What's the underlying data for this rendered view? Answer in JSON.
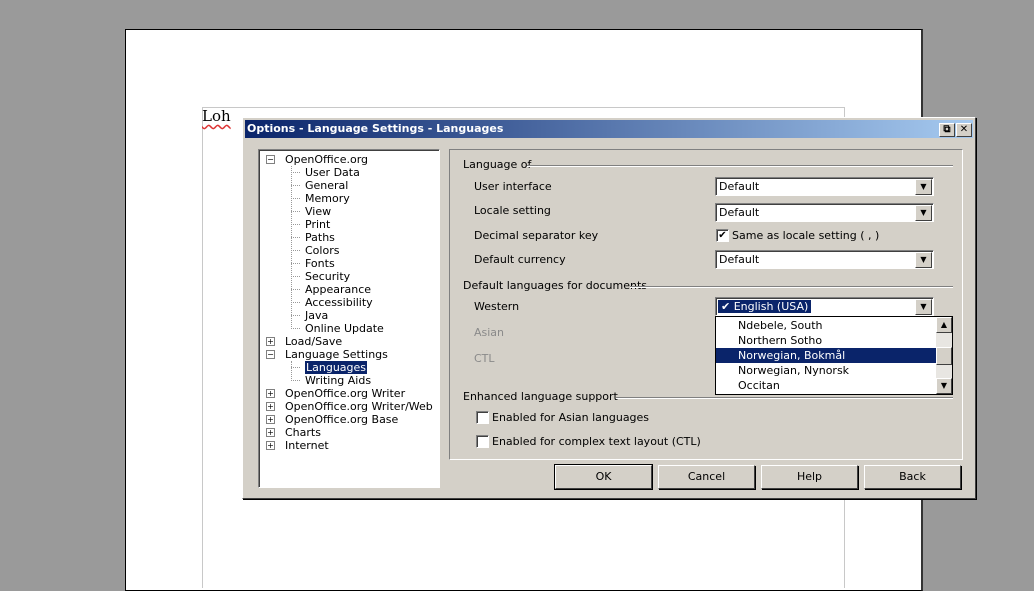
{
  "document": {
    "text": "Loh"
  },
  "dialog": {
    "title": "Options - Language Settings - Languages",
    "restore_icon": "restore-icon",
    "close_icon": "close-icon"
  },
  "tree": [
    {
      "label": "OpenOffice.org",
      "level": 0,
      "expander": "minus"
    },
    {
      "label": "User Data",
      "level": 1
    },
    {
      "label": "General",
      "level": 1
    },
    {
      "label": "Memory",
      "level": 1
    },
    {
      "label": "View",
      "level": 1
    },
    {
      "label": "Print",
      "level": 1
    },
    {
      "label": "Paths",
      "level": 1
    },
    {
      "label": "Colors",
      "level": 1
    },
    {
      "label": "Fonts",
      "level": 1
    },
    {
      "label": "Security",
      "level": 1
    },
    {
      "label": "Appearance",
      "level": 1
    },
    {
      "label": "Accessibility",
      "level": 1
    },
    {
      "label": "Java",
      "level": 1
    },
    {
      "label": "Online Update",
      "level": 1
    },
    {
      "label": "Load/Save",
      "level": 0,
      "expander": "plus"
    },
    {
      "label": "Language Settings",
      "level": 0,
      "expander": "minus"
    },
    {
      "label": "Languages",
      "level": 1,
      "selected": true
    },
    {
      "label": "Writing Aids",
      "level": 1
    },
    {
      "label": "OpenOffice.org Writer",
      "level": 0,
      "expander": "plus"
    },
    {
      "label": "OpenOffice.org Writer/Web",
      "level": 0,
      "expander": "plus"
    },
    {
      "label": "OpenOffice.org Base",
      "level": 0,
      "expander": "plus"
    },
    {
      "label": "Charts",
      "level": 0,
      "expander": "plus"
    },
    {
      "label": "Internet",
      "level": 0,
      "expander": "plus"
    }
  ],
  "language_of": {
    "heading": "Language of",
    "user_interface_label": "User interface",
    "user_interface_value": "Default",
    "locale_setting_label": "Locale setting",
    "locale_setting_value": "Default",
    "decimal_separator_label": "Decimal separator key",
    "decimal_separator_check": "Same as locale setting ( , )",
    "decimal_separator_checked": true,
    "currency_label": "Default currency",
    "currency_value": "Default"
  },
  "default_languages": {
    "heading": "Default languages for documents",
    "western_label": "Western",
    "western_value": "English (USA)",
    "asian_label": "Asian",
    "ctl_label": "CTL",
    "dropdown_items": [
      {
        "label": "Ndebele, South"
      },
      {
        "label": "Northern Sotho"
      },
      {
        "label": "Norwegian, Bokmål",
        "selected": true
      },
      {
        "label": "Norwegian, Nynorsk"
      },
      {
        "label": "Occitan"
      }
    ]
  },
  "enhanced": {
    "heading": "Enhanced language support",
    "asian_check": "Enabled for Asian languages",
    "asian_checked": false,
    "ctl_check": "Enabled for complex text layout (CTL)",
    "ctl_checked": false
  },
  "buttons": {
    "ok": "OK",
    "cancel": "Cancel",
    "help": "Help",
    "back": "Back"
  },
  "colors": {
    "titlebar_start": "#0a246a",
    "titlebar_end": "#a6caf0",
    "selection": "#0a246a",
    "dialog_face": "#d4d0c8"
  }
}
